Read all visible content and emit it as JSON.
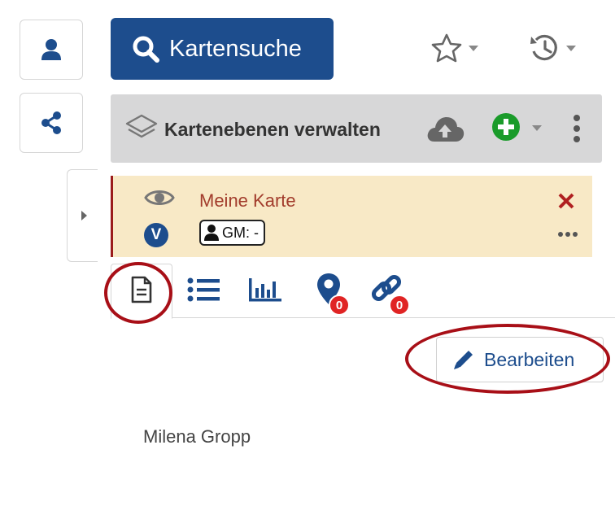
{
  "search": {
    "label": "Kartensuche",
    "icon": "search-icon"
  },
  "layers": {
    "title": "Kartenebenen verwalten"
  },
  "map": {
    "name": "Meine Karte",
    "version_badge": "V",
    "gm_label": "GM: -"
  },
  "tabs": {
    "pins_count": "0",
    "links_count": "0"
  },
  "actions": {
    "edit_label": "Bearbeiten"
  },
  "content": {
    "author": "Milena Gropp"
  },
  "colors": {
    "primary": "#1d4d8d",
    "highlight_ring": "#a80f17",
    "card_bg": "#f8e9c6",
    "danger": "#e02424",
    "add_green": "#1a9b2a"
  }
}
